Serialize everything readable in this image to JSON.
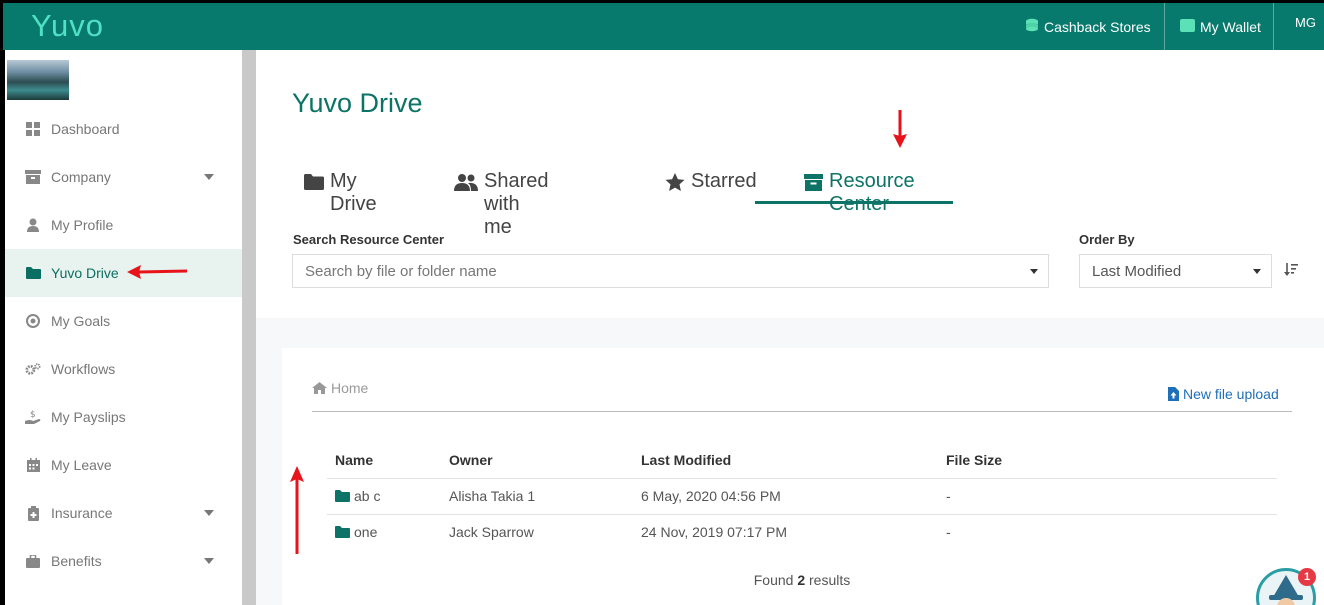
{
  "header": {
    "logo": "Yuvo",
    "cashback_label": "Cashback Stores",
    "wallet_label": "My Wallet",
    "user_initials": "MG"
  },
  "sidebar": {
    "items": [
      {
        "label": "Dashboard",
        "icon": "dashboard-icon"
      },
      {
        "label": "Company",
        "icon": "company-icon",
        "has_caret": true
      },
      {
        "label": "My Profile",
        "icon": "user-icon"
      },
      {
        "label": "Yuvo Drive",
        "icon": "folder-icon",
        "active": true
      },
      {
        "label": "My Goals",
        "icon": "target-icon"
      },
      {
        "label": "Workflows",
        "icon": "gears-icon"
      },
      {
        "label": "My Payslips",
        "icon": "payslip-icon"
      },
      {
        "label": "My Leave",
        "icon": "calendar-icon"
      },
      {
        "label": "Insurance",
        "icon": "insurance-icon",
        "has_caret": true
      },
      {
        "label": "Benefits",
        "icon": "briefcase-icon",
        "has_caret": true
      }
    ]
  },
  "main": {
    "title": "Yuvo Drive",
    "tabs": [
      {
        "label": "My Drive",
        "icon": "folder-icon"
      },
      {
        "label": "Shared with me",
        "icon": "users-icon"
      },
      {
        "label": "Starred",
        "icon": "star-icon"
      },
      {
        "label": "Resource Center",
        "icon": "archive-icon",
        "active": true
      }
    ],
    "search": {
      "label": "Search Resource Center",
      "placeholder": "Search by file or folder name"
    },
    "order": {
      "label": "Order By",
      "value": "Last Modified"
    },
    "breadcrumb": {
      "home": "Home"
    },
    "upload_label": "New file upload",
    "table": {
      "headers": [
        "Name",
        "Owner",
        "Last Modified",
        "File Size"
      ],
      "rows": [
        {
          "name": "ab c",
          "owner": "Alisha Takia 1",
          "modified": "6 May, 2020 04:56 PM",
          "size": "-"
        },
        {
          "name": "one",
          "owner": "Jack Sparrow",
          "modified": "24 Nov, 2019 07:17 PM",
          "size": "-"
        }
      ]
    },
    "results": {
      "prefix": "Found",
      "count": "2",
      "suffix": "results"
    }
  },
  "notification_badge": "1",
  "colors": {
    "brand": "#087a6d",
    "accent": "#0d7366",
    "link": "#1f6fb8",
    "annotation": "#e8121b"
  }
}
